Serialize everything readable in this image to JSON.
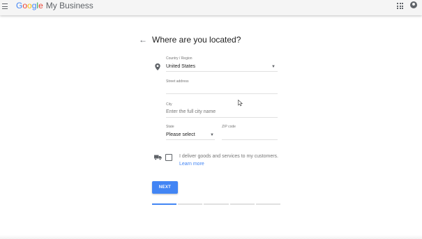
{
  "header": {
    "brand_google_letters": [
      "G",
      "o",
      "o",
      "g",
      "l",
      "e"
    ],
    "product_name": "My Business",
    "menu_icon": "hamburger-menu-icon",
    "apps_icon": "apps-grid-icon",
    "account_icon": "account-avatar-icon"
  },
  "page": {
    "back_icon": "arrow-back-icon",
    "title": "Where are you located?"
  },
  "form": {
    "country": {
      "label": "Country / Region",
      "value": "United States",
      "icon": "location-pin-icon"
    },
    "street": {
      "label": "Street address",
      "value": ""
    },
    "city": {
      "label": "City",
      "placeholder": "Enter the full city name",
      "value": ""
    },
    "state": {
      "label": "State",
      "value": "Please select"
    },
    "zip": {
      "label": "ZIP code",
      "value": ""
    },
    "deliver": {
      "icon": "delivery-truck-icon",
      "checked": false,
      "text": "I deliver goods and services to my customers.",
      "learn_more": "Learn more"
    },
    "next_button": "NEXT"
  },
  "progress": {
    "total_steps": 5,
    "current_step": 1,
    "active_color": "#4285f4",
    "inactive_color": "#e0e0e0"
  },
  "colors": {
    "accent": "#4285f4",
    "topbar_bg": "#f5f5f5"
  }
}
